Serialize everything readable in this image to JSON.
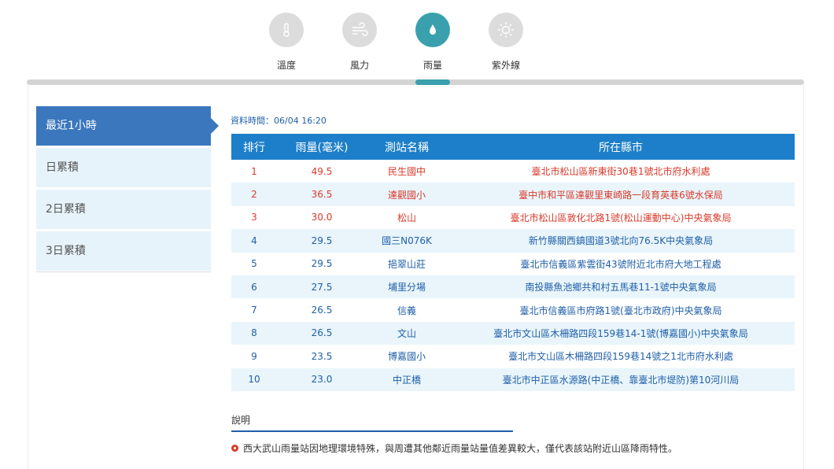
{
  "tabs": [
    {
      "label": "溫度",
      "icon": "thermometer-icon"
    },
    {
      "label": "風力",
      "icon": "wind-icon"
    },
    {
      "label": "雨量",
      "icon": "raindrop-icon"
    },
    {
      "label": "紫外線",
      "icon": "sun-uv-icon"
    }
  ],
  "sidebar": {
    "items": [
      {
        "label": "最近1小時"
      },
      {
        "label": "日累積"
      },
      {
        "label": "2日累積"
      },
      {
        "label": "3日累積"
      }
    ]
  },
  "data_time": "資料時間：06/04 16:20",
  "table": {
    "headers": [
      "排行",
      "雨量(毫米)",
      "測站名稱",
      "所在縣市"
    ],
    "rows": [
      [
        "1",
        "49.5",
        "民生國中",
        "臺北市松山區新東街30巷1號北市府水利處"
      ],
      [
        "2",
        "36.5",
        "達觀國小",
        "臺中市和平區達觀里東崎路一段育英巷6號水保局"
      ],
      [
        "3",
        "30.0",
        "松山",
        "臺北市松山區敦化北路1號(松山運動中心)中央氣象局"
      ],
      [
        "4",
        "29.5",
        "國三N076K",
        "新竹縣關西鎮國道3號北向76.5K中央氣象局"
      ],
      [
        "5",
        "29.5",
        "挹翠山莊",
        "臺北市信義區紫雲街43號附近北市府大地工程處"
      ],
      [
        "6",
        "27.5",
        "埔里分場",
        "南投縣魚池鄉共和村五馬巷11-1號中央氣象局"
      ],
      [
        "7",
        "26.5",
        "信義",
        "臺北市信義區市府路1號(臺北市政府)中央氣象局"
      ],
      [
        "8",
        "26.5",
        "文山",
        "臺北市文山區木柵路四段159巷14-1號(博嘉國小)中央氣象局"
      ],
      [
        "9",
        "23.5",
        "博嘉國小",
        "臺北市文山區木柵路四段159巷14號之1北市府水利處"
      ],
      [
        "10",
        "23.0",
        "中正橋",
        "臺北市中正區水源路(中正橋、靠臺北市堤防)第10河川局"
      ]
    ]
  },
  "note": {
    "title": "說明",
    "text": "西大武山雨量站因地理環境特殊，與周遭其他鄰近雨量站量值差異較大，僅代表該站附近山區降雨特性。"
  },
  "colors": {
    "accent": "#3aa0ad",
    "active_blue": "#3a77bd",
    "header_blue": "#1d7fc9",
    "highlight_red": "#d93a2b"
  }
}
